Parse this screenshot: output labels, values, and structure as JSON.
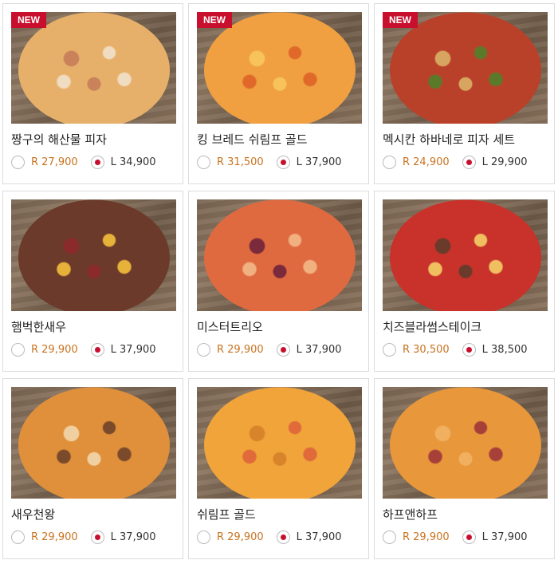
{
  "badge_label": "NEW",
  "menu": [
    {
      "name": "짱구의 해산물 피자",
      "is_new": true,
      "r_price": "R 27,900",
      "l_price": "L 34,900",
      "selected": "L",
      "pizza": [
        "#e7b06a",
        "#f0dcc0",
        "#c9825a"
      ]
    },
    {
      "name": "킹 브레드 쉬림프 골드",
      "is_new": true,
      "r_price": "R 31,500",
      "l_price": "L 37,900",
      "selected": "L",
      "pizza": [
        "#f0a040",
        "#e0692a",
        "#f7c35a"
      ]
    },
    {
      "name": "멕시칸 하바네로 피자 세트",
      "is_new": true,
      "r_price": "R 24,900",
      "l_price": "L 29,900",
      "selected": "L",
      "pizza": [
        "#b9412a",
        "#5a7a2a",
        "#d8a560"
      ]
    },
    {
      "name": "햄벅한새우",
      "is_new": false,
      "r_price": "R 29,900",
      "l_price": "L 37,900",
      "selected": "L",
      "pizza": [
        "#6b3a2a",
        "#e6b23a",
        "#8a2a2a"
      ]
    },
    {
      "name": "미스터트리오",
      "is_new": false,
      "r_price": "R 29,900",
      "l_price": "L 37,900",
      "selected": "L",
      "pizza": [
        "#e06a40",
        "#f0b080",
        "#7a2a3a"
      ]
    },
    {
      "name": "치즈블라썸스테이크",
      "is_new": false,
      "r_price": "R 30,500",
      "l_price": "L 38,500",
      "selected": "L",
      "pizza": [
        "#c8322a",
        "#f0c060",
        "#6a3a2a"
      ]
    },
    {
      "name": "새우천왕",
      "is_new": false,
      "r_price": "R 29,900",
      "l_price": "L 37,900",
      "selected": "L",
      "pizza": [
        "#e0903a",
        "#7a4a2a",
        "#f0d0a0"
      ]
    },
    {
      "name": "쉬림프 골드",
      "is_new": false,
      "r_price": "R 29,900",
      "l_price": "L 37,900",
      "selected": "L",
      "pizza": [
        "#f0a43a",
        "#e06a3a",
        "#d8842a"
      ]
    },
    {
      "name": "하프앤하프",
      "is_new": false,
      "r_price": "R 29,900",
      "l_price": "L 37,900",
      "selected": "L",
      "pizza": [
        "#e8973a",
        "#a8403a",
        "#f0b060"
      ]
    }
  ]
}
